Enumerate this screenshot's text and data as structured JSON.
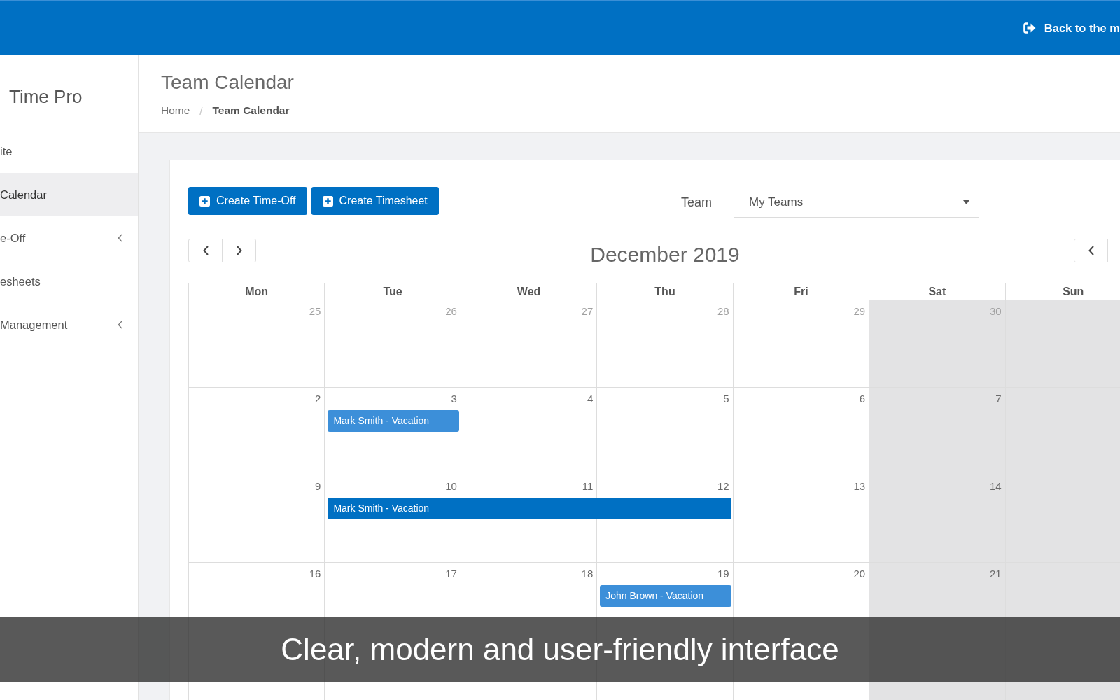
{
  "top_bar": {
    "link": "Back to the m"
  },
  "sidebar": {
    "brand": "Time Pro",
    "items": [
      {
        "label": "ite",
        "selected": false,
        "expandable": false
      },
      {
        "label": "Calendar",
        "selected": true,
        "expandable": false
      },
      {
        "label": "e-Off",
        "selected": false,
        "expandable": true
      },
      {
        "label": "esheets",
        "selected": false,
        "expandable": false
      },
      {
        "label": "Management",
        "selected": false,
        "expandable": true
      }
    ]
  },
  "page_header": {
    "title": "Team Calendar",
    "breadcrumb": {
      "separator": "/",
      "items": [
        {
          "label": "Home",
          "current": false
        },
        {
          "label": "Team Calendar",
          "current": true
        }
      ]
    }
  },
  "toolbar": {
    "buttons": [
      "Create Time-Off",
      "Create Timesheet"
    ],
    "team_filter": {
      "label": "Team",
      "value": "My Teams"
    }
  },
  "calendar": {
    "title": "December 2019",
    "weekdays": [
      {
        "label": "Mon",
        "weekend": false
      },
      {
        "label": "Tue",
        "weekend": false
      },
      {
        "label": "Wed",
        "weekend": false
      },
      {
        "label": "Thu",
        "weekend": false
      },
      {
        "label": "Fri",
        "weekend": false
      },
      {
        "label": "Sat",
        "weekend": true
      },
      {
        "label": "Sun",
        "weekend": true
      }
    ],
    "weeks": [
      {
        "days": [
          {
            "date": "25",
            "other_month": true
          },
          {
            "date": "26",
            "other_month": true
          },
          {
            "date": "27",
            "other_month": true
          },
          {
            "date": "28",
            "other_month": true
          },
          {
            "date": "29",
            "other_month": true
          },
          {
            "date": "30",
            "other_month": true
          }
        ]
      },
      {
        "days": [
          {
            "date": "2",
            "other_month": false
          },
          {
            "date": "3",
            "other_month": false,
            "event": {
              "label": "Mark Smith - Vacation",
              "color": "#3c8fd9"
            }
          },
          {
            "date": "4",
            "other_month": false,
            "continues_event": false
          },
          {
            "date": "5",
            "other_month": false
          },
          {
            "date": "6",
            "other_month": false
          },
          {
            "date": "7",
            "other_month": false
          }
        ]
      },
      {
        "days": [
          {
            "date": "9",
            "other_month": false
          },
          {
            "date": "10",
            "other_month": false,
            "event": {
              "label": "Mark Smith - Vacation",
              "color": "#0070c3"
            }
          },
          {
            "date": "11",
            "other_month": false,
            "continues_event": true
          },
          {
            "date": "12",
            "other_month": false,
            "continues_event": true
          },
          {
            "date": "13",
            "other_month": false,
            "continues_event": false
          },
          {
            "date": "14",
            "other_month": false
          }
        ]
      },
      {
        "days": [
          {
            "date": "16",
            "other_month": false
          },
          {
            "date": "17",
            "other_month": false
          },
          {
            "date": "18",
            "other_month": false
          },
          {
            "date": "19",
            "other_month": false,
            "event": {
              "label": "John Brown - Vacation",
              "color": "#3c8fd9"
            }
          },
          {
            "date": "20",
            "other_month": false,
            "continues_event": false
          },
          {
            "date": "21",
            "other_month": false
          }
        ]
      }
    ]
  },
  "caption": "Clear, modern and user-friendly interface"
}
